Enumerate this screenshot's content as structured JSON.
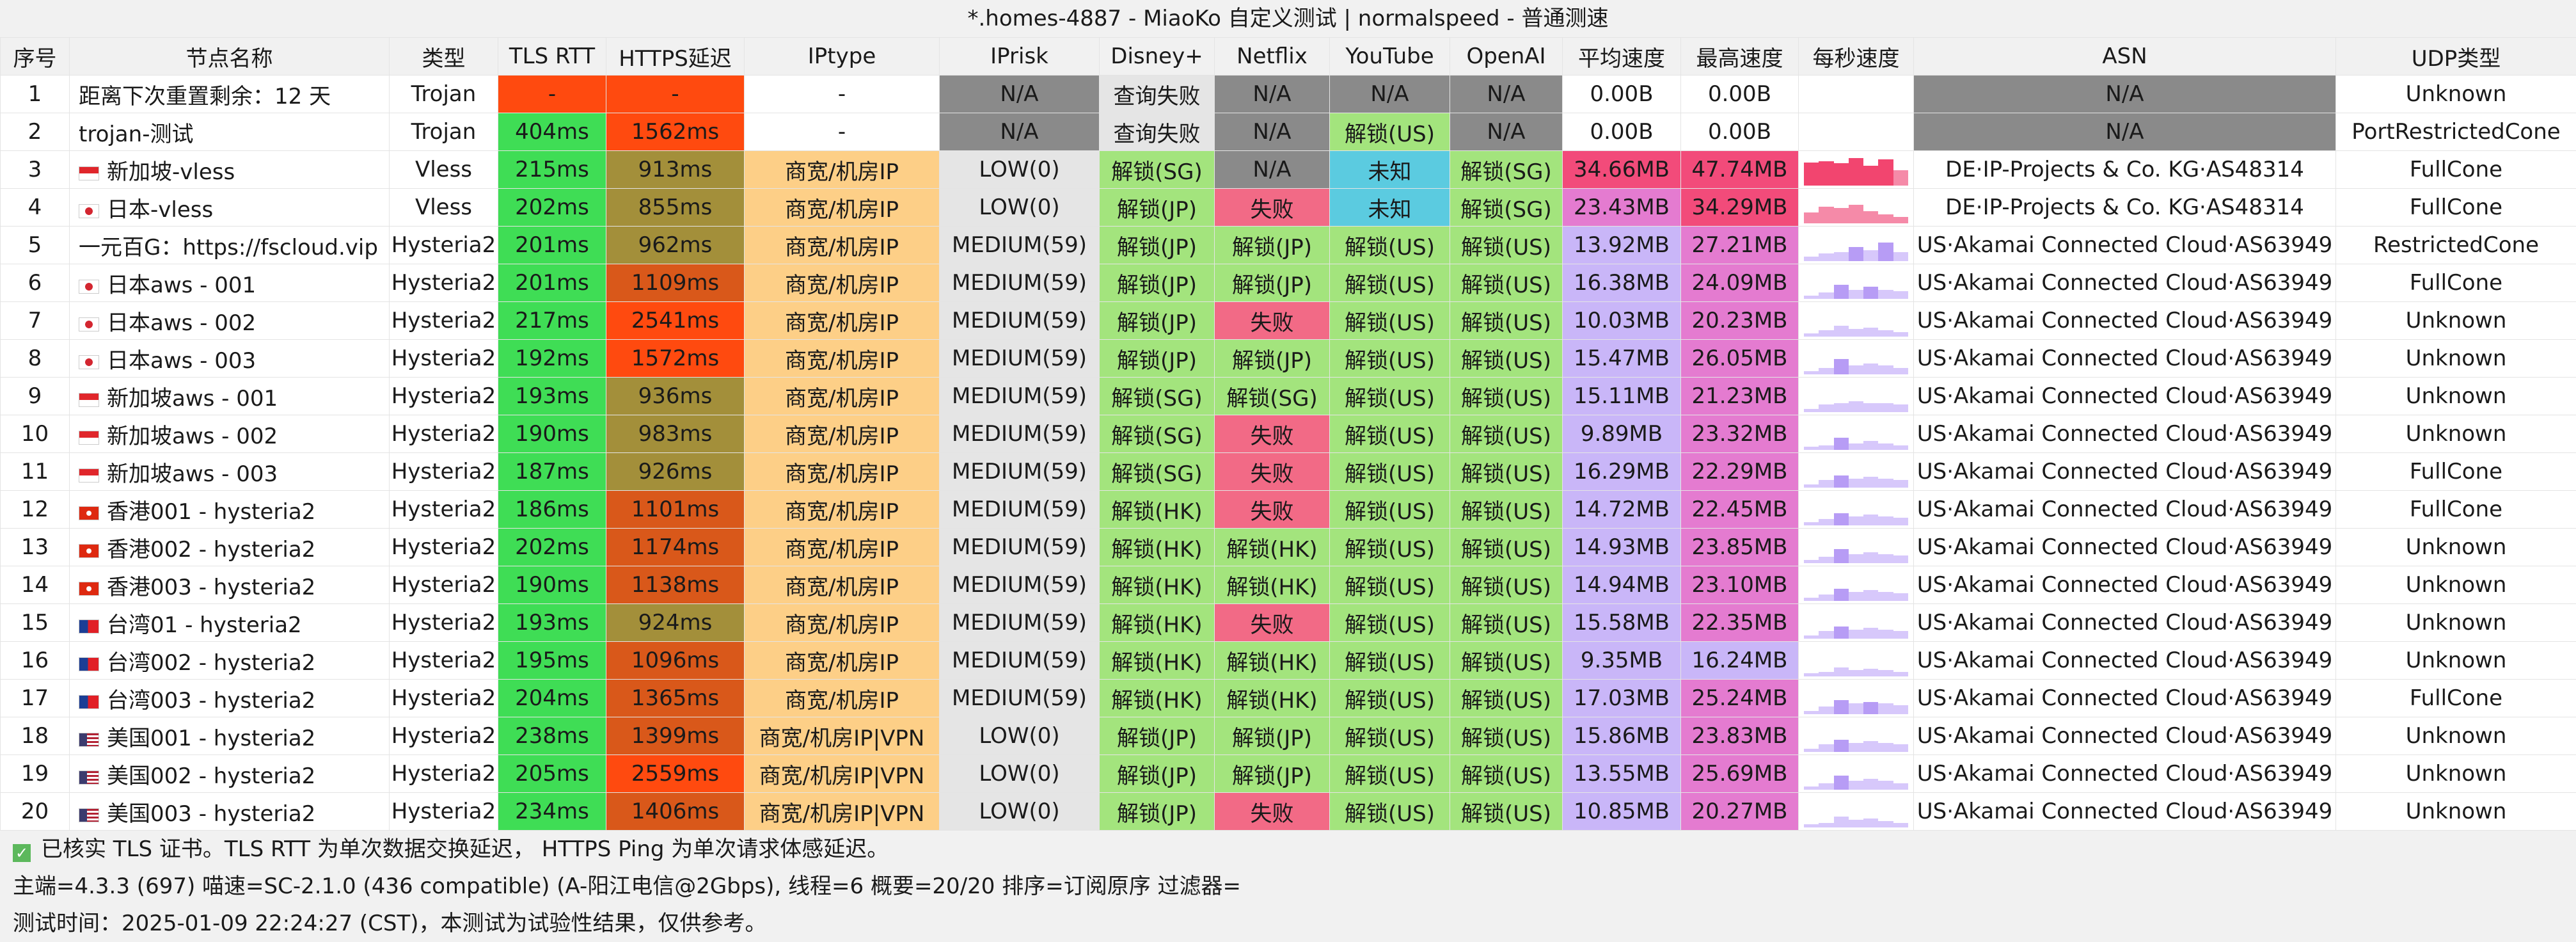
{
  "title": "*.homes-4887 - MiaoKo 自定义测试 | normalspeed - 普通测速",
  "headers": [
    "序号",
    "节点名称",
    "类型",
    "TLS RTT",
    "HTTPS延迟",
    "IPtype",
    "IPrisk",
    "Disney+",
    "Netflix",
    "YouTube",
    "OpenAI",
    "平均速度",
    "最高速度",
    "每秒速度",
    "ASN",
    "UDP类型"
  ],
  "colors": {
    "green": "#3fdd55",
    "red": "#ff4a0f",
    "olive": "#a38f3a",
    "orange_red": "#d9581a",
    "orange": "#fdcf87",
    "grey": "#8a8a8a",
    "lightgrey": "#e5e5e5",
    "unlock": "#a3e47d",
    "fail": "#f26a86",
    "unknown": "#5bcbe0",
    "speed_blue": "#c9b6f8",
    "speed_pink": "#f24b7a",
    "white": "#ffffff"
  },
  "rows": [
    {
      "no": "1",
      "flag": "",
      "name": "距离下次重置剩余：12 天",
      "type": "Trojan",
      "tls": "-",
      "https": "-",
      "iptype": "-",
      "iprisk": "N/A",
      "disney": "查询失败",
      "netflix": "N/A",
      "youtube": "N/A",
      "openai": "N/A",
      "avg": "0.00B",
      "max": "0.00B",
      "asn": "N/A",
      "udp": "Unknown",
      "spark": []
    },
    {
      "no": "2",
      "flag": "",
      "name": "trojan-测试",
      "type": "Trojan",
      "tls": "404ms",
      "https": "1562ms",
      "iptype": "-",
      "iprisk": "N/A",
      "disney": "查询失败",
      "netflix": "N/A",
      "youtube": "解锁(US)",
      "openai": "N/A",
      "avg": "0.00B",
      "max": "0.00B",
      "asn": "N/A",
      "udp": "PortRestrictedCone",
      "spark": []
    },
    {
      "no": "3",
      "flag": "sg",
      "name": "新加坡-vless",
      "type": "Vless",
      "tls": "215ms",
      "https": "913ms",
      "iptype": "商宽/机房IP",
      "iprisk": "LOW(0)",
      "disney": "解锁(SG)",
      "netflix": "N/A",
      "youtube": "未知",
      "openai": "解锁(SG)",
      "avg": "34.66MB",
      "max": "47.74MB",
      "asn": "DE·IP-Projects & Co. KG·AS48314",
      "udp": "FullCone",
      "spark": [
        0.75,
        0.8,
        0.72,
        0.9,
        0.65,
        0.85,
        0.5
      ]
    },
    {
      "no": "4",
      "flag": "jp",
      "name": "日本-vless",
      "type": "Vless",
      "tls": "202ms",
      "https": "855ms",
      "iptype": "商宽/机房IP",
      "iprisk": "LOW(0)",
      "disney": "解锁(JP)",
      "netflix": "失败",
      "youtube": "未知",
      "openai": "解锁(SG)",
      "avg": "23.43MB",
      "max": "34.29MB",
      "asn": "DE·IP-Projects & Co. KG·AS48314",
      "udp": "FullCone",
      "spark": [
        0.35,
        0.55,
        0.5,
        0.6,
        0.4,
        0.3,
        0.2
      ]
    },
    {
      "no": "5",
      "flag": "",
      "name": "一元百G：https://fscloud.vip",
      "type": "Hysteria2",
      "tls": "201ms",
      "https": "962ms",
      "iptype": "商宽/机房IP",
      "iprisk": "MEDIUM(59)",
      "disney": "解锁(JP)",
      "netflix": "解锁(JP)",
      "youtube": "解锁(US)",
      "openai": "解锁(US)",
      "avg": "13.92MB",
      "max": "27.21MB",
      "asn": "US·Akamai Connected Cloud·AS63949",
      "udp": "RestrictedCone",
      "spark": [
        0.15,
        0.25,
        0.3,
        0.45,
        0.35,
        0.6,
        0.3
      ]
    },
    {
      "no": "6",
      "flag": "jp",
      "name": "日本aws - 001",
      "type": "Hysteria2",
      "tls": "201ms",
      "https": "1109ms",
      "iptype": "商宽/机房IP",
      "iprisk": "MEDIUM(59)",
      "disney": "解锁(JP)",
      "netflix": "解锁(JP)",
      "youtube": "解锁(US)",
      "openai": "解锁(US)",
      "avg": "16.38MB",
      "max": "24.09MB",
      "asn": "US·Akamai Connected Cloud·AS63949",
      "udp": "FullCone",
      "spark": [
        0.1,
        0.2,
        0.45,
        0.3,
        0.4,
        0.3,
        0.25
      ]
    },
    {
      "no": "7",
      "flag": "jp",
      "name": "日本aws - 002",
      "type": "Hysteria2",
      "tls": "217ms",
      "https": "2541ms",
      "iptype": "商宽/机房IP",
      "iprisk": "MEDIUM(59)",
      "disney": "解锁(JP)",
      "netflix": "失败",
      "youtube": "解锁(US)",
      "openai": "解锁(US)",
      "avg": "10.03MB",
      "max": "20.23MB",
      "asn": "US·Akamai Connected Cloud·AS63949",
      "udp": "Unknown",
      "spark": [
        0.1,
        0.2,
        0.35,
        0.25,
        0.3,
        0.2,
        0.15
      ]
    },
    {
      "no": "8",
      "flag": "jp",
      "name": "日本aws - 003",
      "type": "Hysteria2",
      "tls": "192ms",
      "https": "1572ms",
      "iptype": "商宽/机房IP",
      "iprisk": "MEDIUM(59)",
      "disney": "解锁(JP)",
      "netflix": "解锁(JP)",
      "youtube": "解锁(US)",
      "openai": "解锁(US)",
      "avg": "15.47MB",
      "max": "26.05MB",
      "asn": "US·Akamai Connected Cloud·AS63949",
      "udp": "Unknown",
      "spark": [
        0.1,
        0.2,
        0.5,
        0.3,
        0.35,
        0.3,
        0.2
      ]
    },
    {
      "no": "9",
      "flag": "sg",
      "name": "新加坡aws - 001",
      "type": "Hysteria2",
      "tls": "193ms",
      "https": "936ms",
      "iptype": "商宽/机房IP",
      "iprisk": "MEDIUM(59)",
      "disney": "解锁(SG)",
      "netflix": "解锁(SG)",
      "youtube": "解锁(US)",
      "openai": "解锁(US)",
      "avg": "15.11MB",
      "max": "21.23MB",
      "asn": "US·Akamai Connected Cloud·AS63949",
      "udp": "Unknown",
      "spark": [
        0.1,
        0.25,
        0.3,
        0.35,
        0.3,
        0.3,
        0.25
      ]
    },
    {
      "no": "10",
      "flag": "sg",
      "name": "新加坡aws - 002",
      "type": "Hysteria2",
      "tls": "190ms",
      "https": "983ms",
      "iptype": "商宽/机房IP",
      "iprisk": "MEDIUM(59)",
      "disney": "解锁(SG)",
      "netflix": "失败",
      "youtube": "解锁(US)",
      "openai": "解锁(US)",
      "avg": "9.89MB",
      "max": "23.32MB",
      "asn": "US·Akamai Connected Cloud·AS63949",
      "udp": "Unknown",
      "spark": [
        0.1,
        0.15,
        0.4,
        0.2,
        0.3,
        0.2,
        0.15
      ]
    },
    {
      "no": "11",
      "flag": "sg",
      "name": "新加坡aws - 003",
      "type": "Hysteria2",
      "tls": "187ms",
      "https": "926ms",
      "iptype": "商宽/机房IP",
      "iprisk": "MEDIUM(59)",
      "disney": "解锁(SG)",
      "netflix": "失败",
      "youtube": "解锁(US)",
      "openai": "解锁(US)",
      "avg": "16.29MB",
      "max": "22.29MB",
      "asn": "US·Akamai Connected Cloud·AS63949",
      "udp": "FullCone",
      "spark": [
        0.1,
        0.25,
        0.4,
        0.3,
        0.35,
        0.3,
        0.25
      ]
    },
    {
      "no": "12",
      "flag": "hk",
      "name": "香港001 - hysteria2",
      "type": "Hysteria2",
      "tls": "186ms",
      "https": "1101ms",
      "iptype": "商宽/机房IP",
      "iprisk": "MEDIUM(59)",
      "disney": "解锁(HK)",
      "netflix": "失败",
      "youtube": "解锁(US)",
      "openai": "解锁(US)",
      "avg": "14.72MB",
      "max": "22.45MB",
      "asn": "US·Akamai Connected Cloud·AS63949",
      "udp": "FullCone",
      "spark": [
        0.1,
        0.2,
        0.4,
        0.3,
        0.35,
        0.3,
        0.25
      ]
    },
    {
      "no": "13",
      "flag": "hk",
      "name": "香港002 - hysteria2",
      "type": "Hysteria2",
      "tls": "202ms",
      "https": "1174ms",
      "iptype": "商宽/机房IP",
      "iprisk": "MEDIUM(59)",
      "disney": "解锁(HK)",
      "netflix": "解锁(HK)",
      "youtube": "解锁(US)",
      "openai": "解锁(US)",
      "avg": "14.93MB",
      "max": "23.85MB",
      "asn": "US·Akamai Connected Cloud·AS63949",
      "udp": "Unknown",
      "spark": [
        0.1,
        0.2,
        0.45,
        0.3,
        0.35,
        0.3,
        0.25
      ]
    },
    {
      "no": "14",
      "flag": "hk",
      "name": "香港003 - hysteria2",
      "type": "Hysteria2",
      "tls": "190ms",
      "https": "1138ms",
      "iptype": "商宽/机房IP",
      "iprisk": "MEDIUM(59)",
      "disney": "解锁(HK)",
      "netflix": "解锁(HK)",
      "youtube": "解锁(US)",
      "openai": "解锁(US)",
      "avg": "14.94MB",
      "max": "23.10MB",
      "asn": "US·Akamai Connected Cloud·AS63949",
      "udp": "Unknown",
      "spark": [
        0.1,
        0.2,
        0.4,
        0.3,
        0.35,
        0.3,
        0.25
      ]
    },
    {
      "no": "15",
      "flag": "tw",
      "name": "台湾01 - hysteria2",
      "type": "Hysteria2",
      "tls": "193ms",
      "https": "924ms",
      "iptype": "商宽/机房IP",
      "iprisk": "MEDIUM(59)",
      "disney": "解锁(HK)",
      "netflix": "失败",
      "youtube": "解锁(US)",
      "openai": "解锁(US)",
      "avg": "15.58MB",
      "max": "22.35MB",
      "asn": "US·Akamai Connected Cloud·AS63949",
      "udp": "Unknown",
      "spark": [
        0.1,
        0.25,
        0.4,
        0.3,
        0.35,
        0.3,
        0.25
      ]
    },
    {
      "no": "16",
      "flag": "tw",
      "name": "台湾002 - hysteria2",
      "type": "Hysteria2",
      "tls": "195ms",
      "https": "1096ms",
      "iptype": "商宽/机房IP",
      "iprisk": "MEDIUM(59)",
      "disney": "解锁(HK)",
      "netflix": "解锁(HK)",
      "youtube": "解锁(US)",
      "openai": "解锁(US)",
      "avg": "9.35MB",
      "max": "16.24MB",
      "asn": "US·Akamai Connected Cloud·AS63949",
      "udp": "Unknown",
      "spark": [
        0.1,
        0.15,
        0.3,
        0.2,
        0.25,
        0.2,
        0.15
      ]
    },
    {
      "no": "17",
      "flag": "tw",
      "name": "台湾003 - hysteria2",
      "type": "Hysteria2",
      "tls": "204ms",
      "https": "1365ms",
      "iptype": "商宽/机房IP",
      "iprisk": "MEDIUM(59)",
      "disney": "解锁(HK)",
      "netflix": "解锁(HK)",
      "youtube": "解锁(US)",
      "openai": "解锁(US)",
      "avg": "17.03MB",
      "max": "25.24MB",
      "asn": "US·Akamai Connected Cloud·AS63949",
      "udp": "FullCone",
      "spark": [
        0.1,
        0.25,
        0.45,
        0.35,
        0.4,
        0.35,
        0.3
      ]
    },
    {
      "no": "18",
      "flag": "us",
      "name": "美国001 - hysteria2",
      "type": "Hysteria2",
      "tls": "238ms",
      "https": "1399ms",
      "iptype": "商宽/机房IP|VPN",
      "iprisk": "LOW(0)",
      "disney": "解锁(JP)",
      "netflix": "解锁(JP)",
      "youtube": "解锁(US)",
      "openai": "解锁(US)",
      "avg": "15.86MB",
      "max": "23.83MB",
      "asn": "US·Akamai Connected Cloud·AS63949",
      "udp": "Unknown",
      "spark": [
        0.1,
        0.25,
        0.4,
        0.3,
        0.35,
        0.3,
        0.25
      ]
    },
    {
      "no": "19",
      "flag": "us",
      "name": "美国002 - hysteria2",
      "type": "Hysteria2",
      "tls": "205ms",
      "https": "2559ms",
      "iptype": "商宽/机房IP|VPN",
      "iprisk": "LOW(0)",
      "disney": "解锁(JP)",
      "netflix": "解锁(JP)",
      "youtube": "解锁(US)",
      "openai": "解锁(US)",
      "avg": "13.55MB",
      "max": "25.69MB",
      "asn": "US·Akamai Connected Cloud·AS63949",
      "udp": "Unknown",
      "spark": [
        0.1,
        0.2,
        0.45,
        0.3,
        0.35,
        0.3,
        0.2
      ]
    },
    {
      "no": "20",
      "flag": "us",
      "name": "美国003 - hysteria2",
      "type": "Hysteria2",
      "tls": "234ms",
      "https": "1406ms",
      "iptype": "商宽/机房IP|VPN",
      "iprisk": "LOW(0)",
      "disney": "解锁(JP)",
      "netflix": "失败",
      "youtube": "解锁(US)",
      "openai": "解锁(US)",
      "avg": "10.85MB",
      "max": "20.27MB",
      "asn": "US·Akamai Connected Cloud·AS63949",
      "udp": "Unknown",
      "spark": [
        0.1,
        0.15,
        0.35,
        0.25,
        0.3,
        0.2,
        0.15
      ]
    }
  ],
  "footer": {
    "line1": "已核实 TLS 证书。TLS RTT 为单次数据交换延迟， HTTPS Ping 为单次请求体感延迟。",
    "line2": "主端=4.3.3 (697) 喵速=SC-2.1.0 (436 compatible) (A-阳江电信@2Gbps), 线程=6 概要=20/20 排序=订阅原序 过滤器=",
    "line3": "测试时间：2025-01-09 22:24:27 (CST)，本测试为试验性结果，仅供参考。"
  }
}
